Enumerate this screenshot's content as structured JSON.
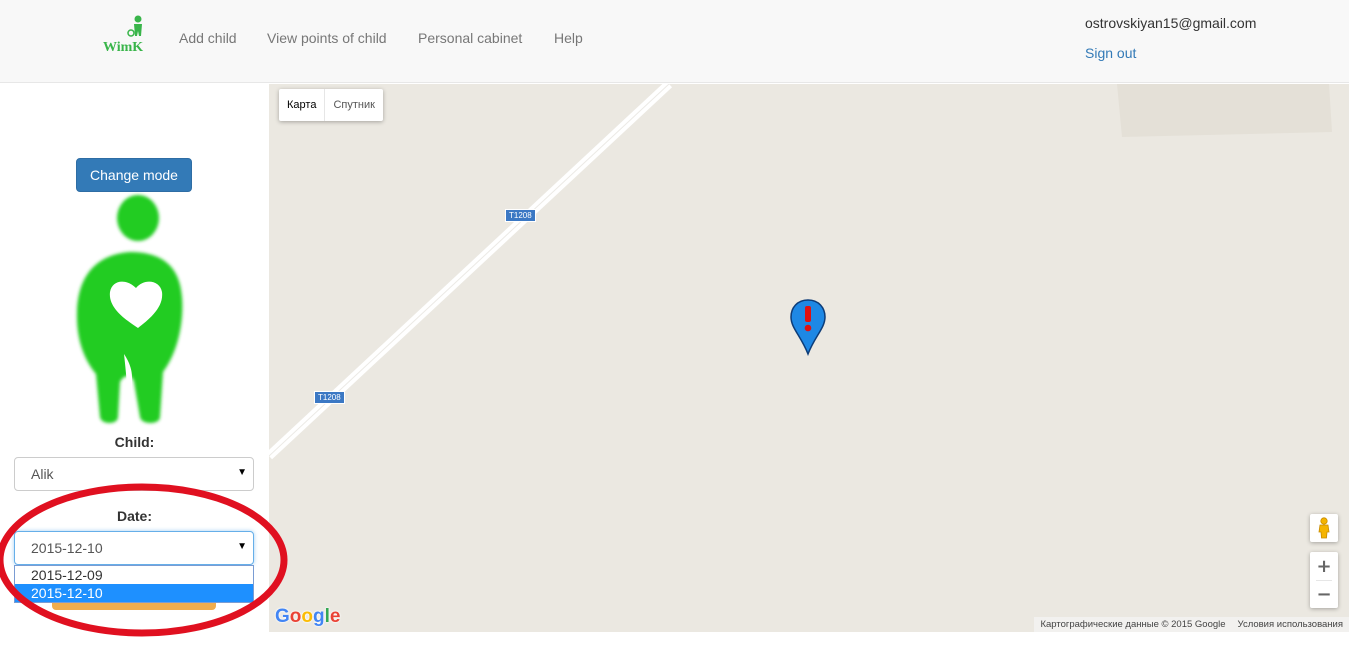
{
  "navbar": {
    "brand": "WimK",
    "links": [
      "Add child",
      "View points of child",
      "Personal cabinet",
      "Help"
    ],
    "user_email": "ostrovskiyan15@gmail.com",
    "sign_out": "Sign out"
  },
  "sidebar": {
    "change_mode_label": "Change mode",
    "child_label": "Child:",
    "child_selected": "Alik",
    "date_label": "Date:",
    "date_selected": "2015-12-10",
    "date_options": [
      "2015-12-09",
      "2015-12-10"
    ]
  },
  "map": {
    "type_buttons": [
      "Карта",
      "Спутник"
    ],
    "road_labels": [
      "T1208",
      "T1208"
    ],
    "attribution": "Картографические данные © 2015 Google",
    "terms": "Условия использования",
    "zoom_in": "+",
    "zoom_out": "−"
  },
  "colors": {
    "primary": "#337ab7",
    "brand_green": "#39b54a",
    "figure_green": "#22cc22",
    "highlight_ellipse": "#e01020",
    "map_bg": "#ebe8e1",
    "marker_blue": "#1565c0",
    "marker_red": "#e01010"
  },
  "icons": {
    "brand": "wimk-logo-icon",
    "marker": "alert-map-marker-icon",
    "pegman": "street-view-pegman-icon"
  }
}
